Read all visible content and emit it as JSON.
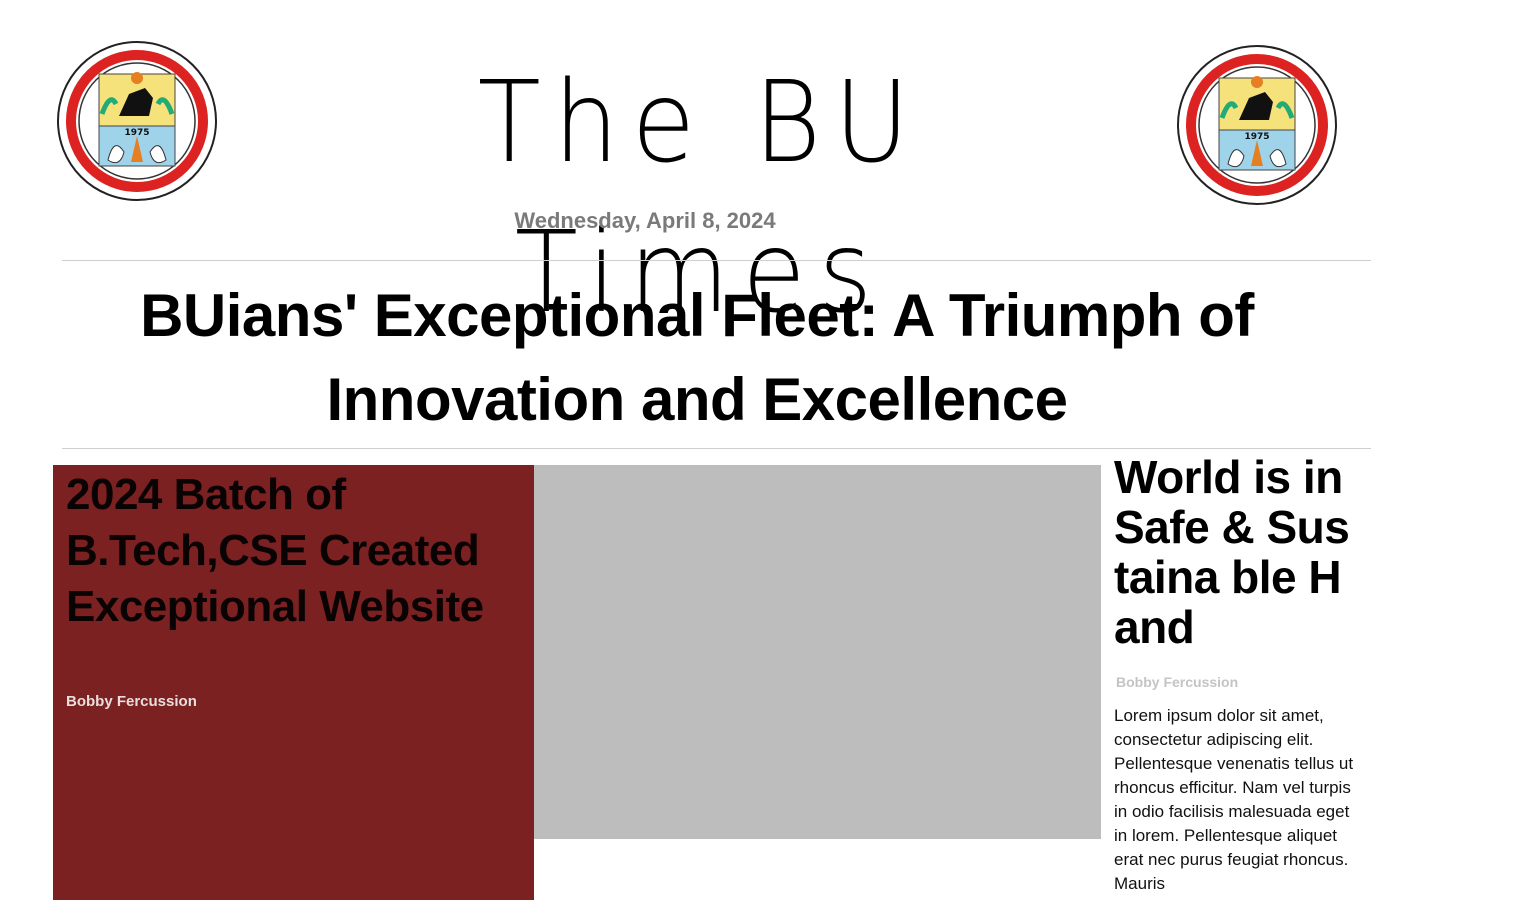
{
  "header": {
    "title": "The BU Times",
    "date": "Wednesday, April 8, 2024",
    "logo_year": "1975"
  },
  "lead": {
    "headline": "BUians' Exceptional Fleet: A Triumph of Innovation and Excellence"
  },
  "feature": {
    "title": "2024 Batch of B.Tech,CSE Created Exceptional Website",
    "author": "Bobby Fercussion",
    "background_color": "#7c2121"
  },
  "image": {
    "icon": "image-placeholder-icon",
    "color": "#bdbdbd"
  },
  "side_article": {
    "title": "World is in Safe & Sustaina ble Hand",
    "author": "Bobby Fercussion",
    "body": "Lorem ipsum dolor sit amet, consectetur adipiscing elit. Pellentesque venenatis tellus ut rhoncus efficitur. Nam vel turpis in odio facilisis malesuada eget in lorem. Pellentesque aliquet erat nec purus feugiat rhoncus. Mauris"
  }
}
